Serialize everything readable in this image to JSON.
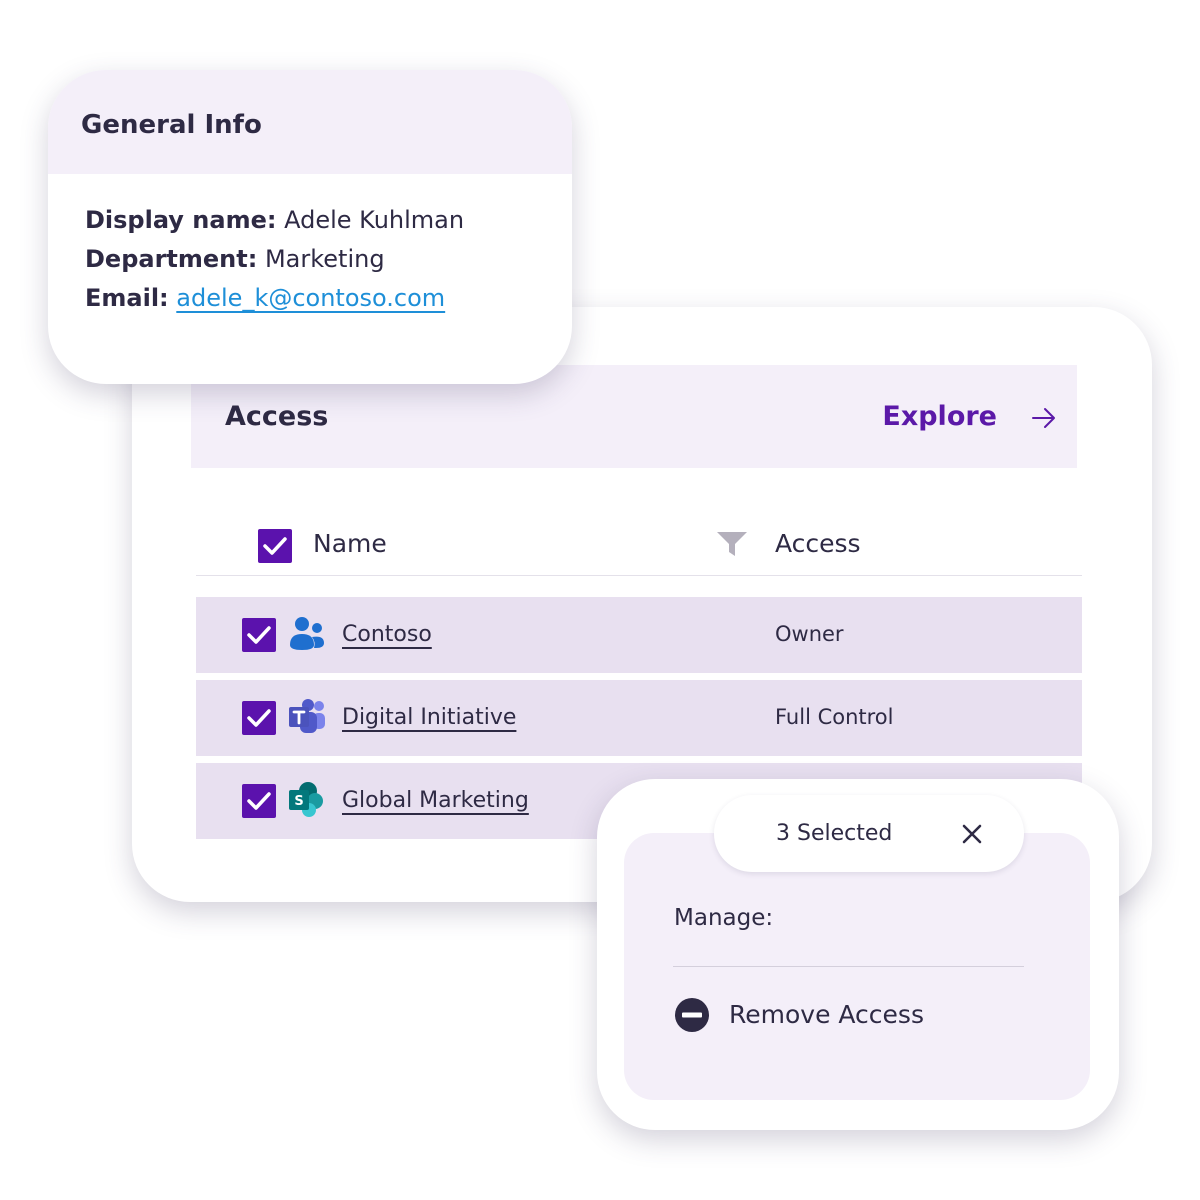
{
  "general_info": {
    "title": "General Info",
    "display_name_label": "Display name:",
    "display_name_value": "Adele Kuhlman",
    "department_label": "Department:",
    "department_value": "Marketing",
    "email_label": "Email:",
    "email_value": "adele_k@contoso.com"
  },
  "access": {
    "title": "Access",
    "explore_label": "Explore",
    "columns": {
      "name": "Name",
      "access": "Access"
    },
    "rows": [
      {
        "name": "Contoso",
        "access": "Owner",
        "icon": "people-icon",
        "checked": true
      },
      {
        "name": "Digital Initiative",
        "access": "Full Control",
        "icon": "teams-icon",
        "checked": true
      },
      {
        "name": "Global Marketing",
        "access": "",
        "icon": "sharepoint-icon",
        "checked": true
      }
    ]
  },
  "selection": {
    "count_label": "3 Selected",
    "manage_label": "Manage:",
    "remove_label": "Remove Access"
  },
  "colors": {
    "accent": "#5b12ad",
    "header_bg": "#f4eff9",
    "row_bg": "#e8e0f0",
    "link": "#1e8fd8",
    "text": "#2e2a44"
  }
}
